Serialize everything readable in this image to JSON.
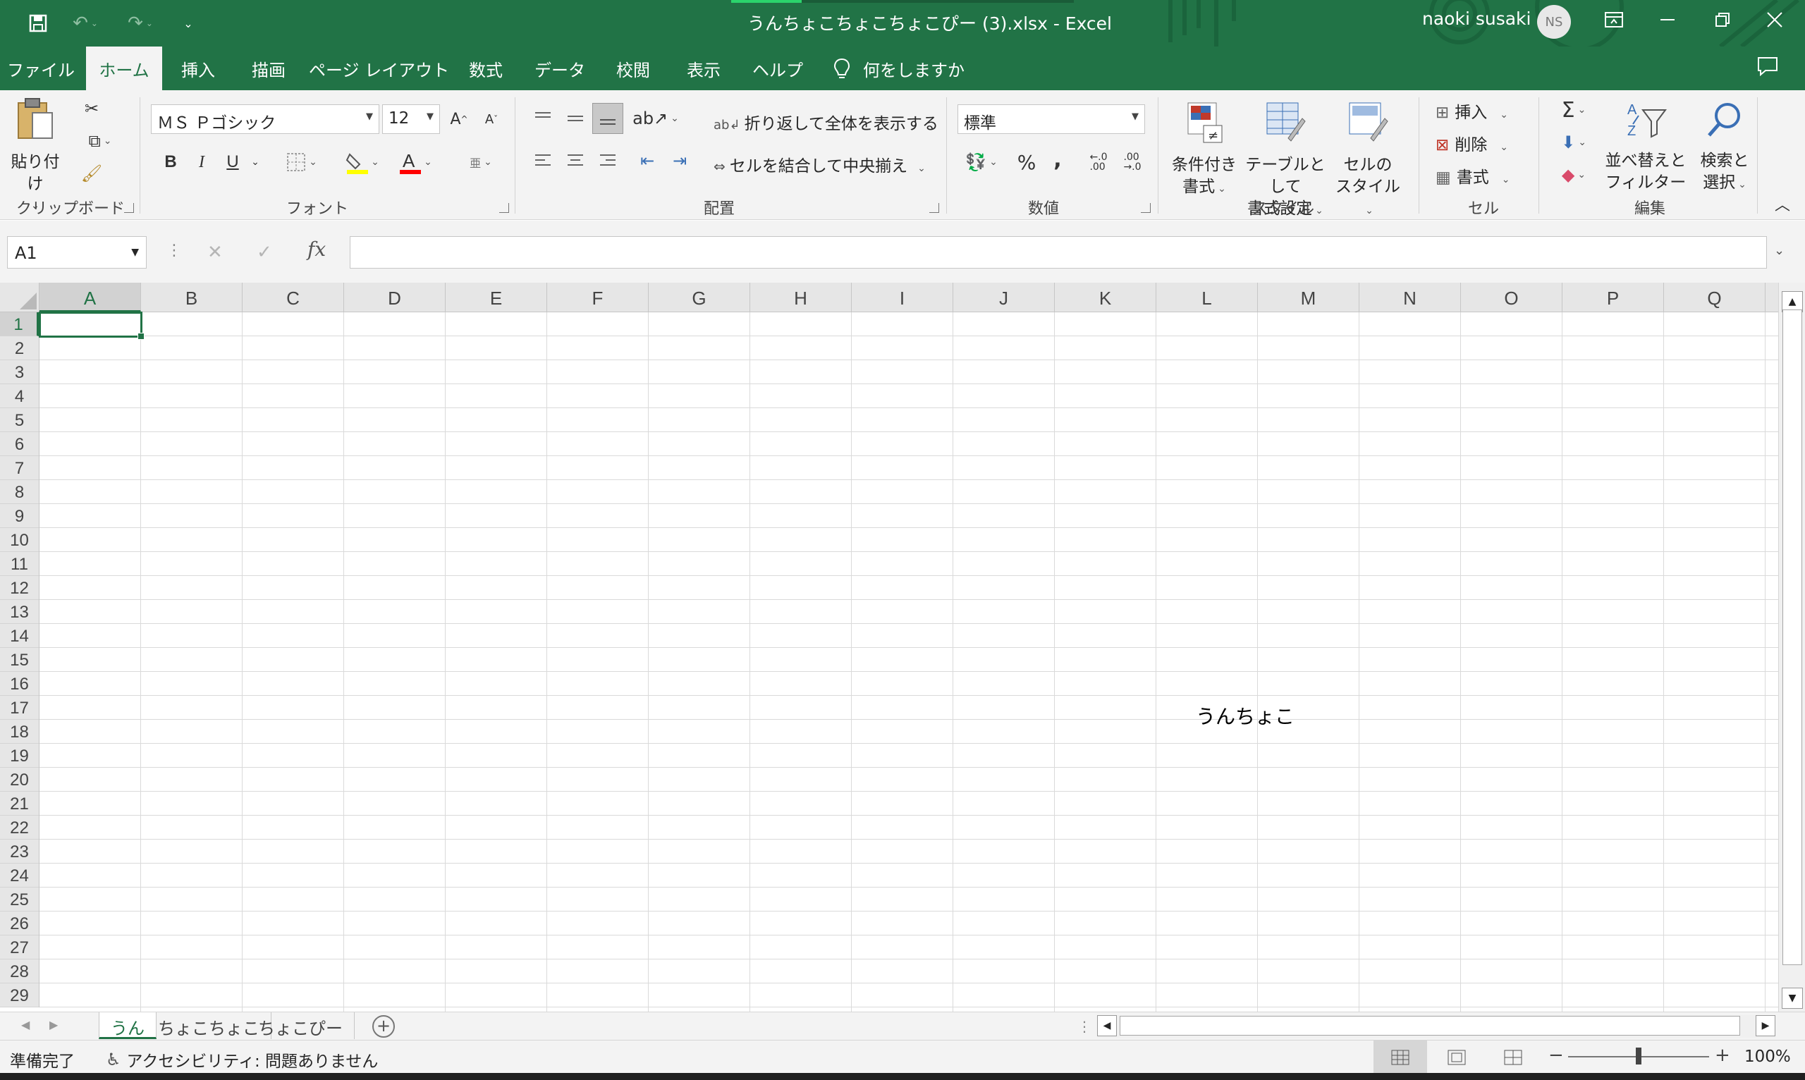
{
  "window": {
    "title": "うんちょこちょこちょこぴー (3).xlsx  -  Excel",
    "user_name": "naoki susaki",
    "user_initials": "NS",
    "accent": "#217346"
  },
  "tabs": [
    "ファイル",
    "ホーム",
    "挿入",
    "描画",
    "ページ レイアウト",
    "数式",
    "データ",
    "校閲",
    "表示",
    "ヘルプ"
  ],
  "tell_me": "何をしますか",
  "ribbon": {
    "clipboard": {
      "label": "クリップボード",
      "paste": "貼り付け"
    },
    "font": {
      "label": "フォント",
      "font_name": "ＭＳ Ｐゴシック",
      "font_size": "12",
      "bold": "B",
      "italic": "I",
      "underline": "U"
    },
    "alignment": {
      "label": "配置",
      "wrap_text": "折り返して全体を表示する",
      "merge_center": "セルを結合して中央揃え"
    },
    "number": {
      "label": "数値",
      "format": "標準",
      "percent": "%",
      "comma": ","
    },
    "styles": {
      "label": "スタイル",
      "conditional_1": "条件付き",
      "conditional_2": "書式",
      "table_1": "テーブルとして",
      "table_2": "書式設定",
      "cell_1": "セルの",
      "cell_2": "スタイル"
    },
    "cells": {
      "label": "セル",
      "insert": "挿入",
      "delete": "削除",
      "format": "書式"
    },
    "editing": {
      "label": "編集",
      "sort_1": "並べ替えと",
      "sort_2": "フィルター",
      "find_1": "検索と",
      "find_2": "選択"
    }
  },
  "formula_bar": {
    "name_box": "A1",
    "fx": "fx",
    "value": ""
  },
  "columns": [
    "A",
    "B",
    "C",
    "D",
    "E",
    "F",
    "G",
    "H",
    "I",
    "J",
    "K",
    "L",
    "M",
    "N",
    "O",
    "P",
    "Q"
  ],
  "rows": [
    "1",
    "2",
    "3",
    "4",
    "5",
    "6",
    "7",
    "8",
    "9",
    "10",
    "11",
    "12",
    "13",
    "14",
    "15",
    "16",
    "17",
    "18",
    "19",
    "20",
    "21",
    "22",
    "23",
    "24",
    "25",
    "26",
    "27",
    "28",
    "29"
  ],
  "cell_contents": {
    "L16": "うんちょこ"
  },
  "sheets": [
    "うん",
    "ちょこちょこ",
    "ちょこぴー"
  ],
  "status": {
    "ready": "準備完了",
    "accessibility": "アクセシビリティ: 問題ありません",
    "zoom": "100%"
  }
}
